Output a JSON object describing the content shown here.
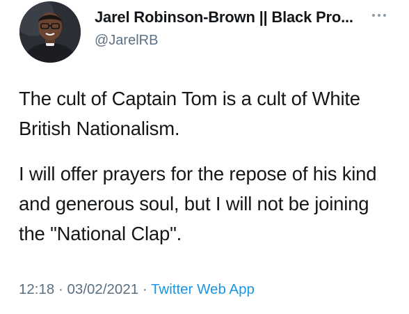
{
  "author": {
    "display_name": "Jarel Robinson-Brown || Black Pro...",
    "handle": "@JarelRB",
    "avatar_icon": "profile-photo"
  },
  "tweet": {
    "paragraph_1": "The cult of Captain Tom is a cult of White British Nationalism.",
    "paragraph_2": "I will offer prayers for the repose of his kind and generous soul, but I will not be joining the \"National Clap\"."
  },
  "meta": {
    "time": "12:18",
    "separator": " · ",
    "date": "03/02/2021",
    "source": "Twitter Web App"
  },
  "icons": {
    "more": "more-options-icon"
  },
  "colors": {
    "text": "#14171a",
    "secondary": "#5b7083",
    "link": "#1b95e0"
  }
}
